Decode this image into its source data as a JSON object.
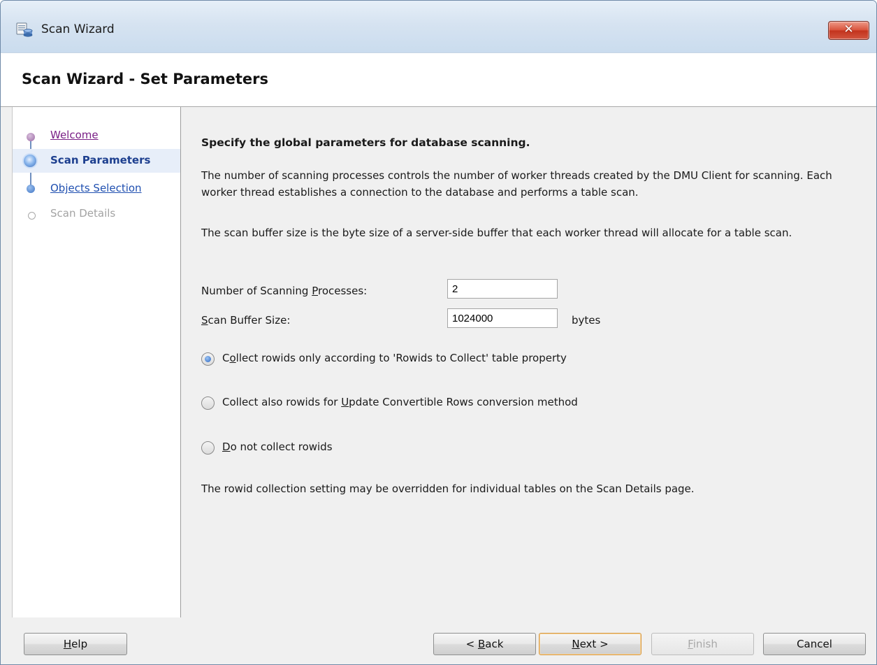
{
  "window": {
    "title": "Scan Wizard",
    "close_label": "✕"
  },
  "header": {
    "title": "Scan Wizard - Set Parameters"
  },
  "nav": {
    "items": [
      {
        "label": "Welcome",
        "state": "visited"
      },
      {
        "label": "Scan Parameters",
        "state": "current"
      },
      {
        "label": "Objects Selection",
        "state": "link"
      },
      {
        "label": "Scan Details",
        "state": "disabled"
      }
    ]
  },
  "content": {
    "heading": "Specify the global parameters for database scanning.",
    "para1": "The number of scanning processes controls the number of worker threads created by the DMU Client for scanning. Each worker thread establishes a connection to the database and performs a table scan.",
    "para2": "The scan buffer size is the byte size of a server-side buffer that each worker thread will allocate for a table scan.",
    "processes_label_pre": "Number of Scanning ",
    "processes_label_ul": "P",
    "processes_label_post": "rocesses:",
    "processes_value": "2",
    "buffer_label_ul": "S",
    "buffer_label_post": "can Buffer Size:",
    "buffer_value": "1024000",
    "buffer_unit": "bytes",
    "radios": [
      {
        "pre": "C",
        "ul": "o",
        "post": "llect rowids only according to 'Rowids to Collect' table property",
        "checked": true
      },
      {
        "pre": "Collect also rowids for ",
        "ul": "U",
        "post": "pdate Convertible Rows conversion method",
        "checked": false
      },
      {
        "pre": "",
        "ul": "D",
        "post": "o not collect rowids",
        "checked": false
      }
    ],
    "note": "The rowid collection setting may be overridden for individual tables on the Scan Details page."
  },
  "buttons": {
    "help_ul": "H",
    "help_post": "elp",
    "back_pre": "< ",
    "back_ul": "B",
    "back_post": "ack",
    "next_ul": "N",
    "next_post": "ext >",
    "finish_ul": "F",
    "finish_post": "inish",
    "cancel": "Cancel"
  },
  "colors": {
    "link": "#1f4fb0",
    "visited": "#7a1f86",
    "current": "#1d3f8f",
    "default_button_border": "#d79a45"
  }
}
